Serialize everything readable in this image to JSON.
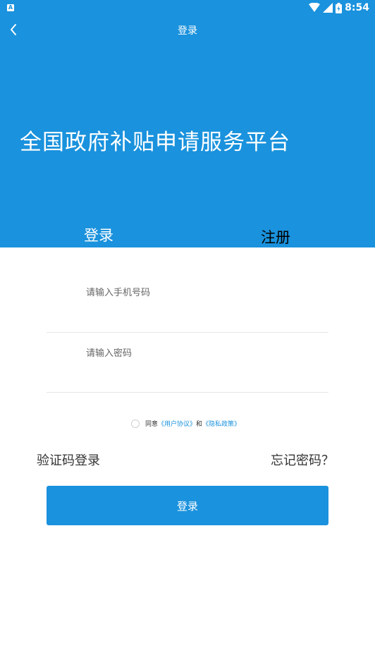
{
  "status_bar": {
    "app_icon": "A",
    "time": "8:54"
  },
  "app_bar": {
    "title": "登录"
  },
  "hero": {
    "title": "全国政府补贴申请服务平台"
  },
  "tabs": [
    {
      "label": "登录"
    },
    {
      "label": "注册"
    }
  ],
  "form": {
    "phone_placeholder": "请输入手机号码",
    "password_placeholder": "请输入密码"
  },
  "agreement": {
    "prefix": "同意",
    "user_agreement": "《用户协议》",
    "and": "和",
    "privacy_policy": "《隐私政策》"
  },
  "links": {
    "sms_login": "验证码登录",
    "forgot_password": "忘记密码？"
  },
  "submit_label": "登录",
  "colors": {
    "primary": "#1a92dd"
  }
}
